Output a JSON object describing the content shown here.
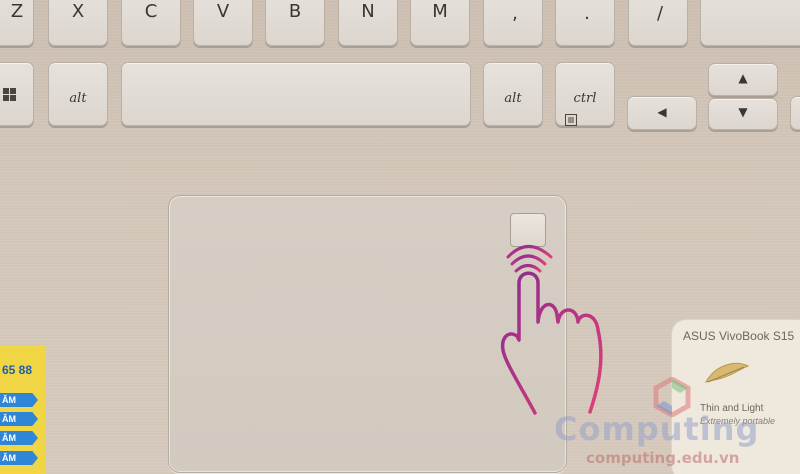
{
  "keys_row1": [
    {
      "id": "z",
      "label": "Z"
    },
    {
      "id": "x",
      "label": "X"
    },
    {
      "id": "c",
      "label": "C"
    },
    {
      "id": "v",
      "label": "V"
    },
    {
      "id": "b",
      "label": "B"
    },
    {
      "id": "n",
      "label": "N"
    },
    {
      "id": "m",
      "label": "M"
    },
    {
      "id": "comma",
      "label": ",",
      "sub": "<"
    },
    {
      "id": "period",
      "label": ".",
      "sub": ">"
    },
    {
      "id": "slash",
      "label": "/",
      "sub": "?"
    }
  ],
  "keys_row2": {
    "windows_icon": "windows-icon",
    "alt_left": "alt",
    "alt_right": "alt",
    "ctrl_right": "ctrl",
    "menu_icon": "menu-icon",
    "arrow_up": "▲",
    "arrow_down": "▼",
    "arrow_left": "◀"
  },
  "sticker_left": {
    "number": "65 88",
    "tags": [
      "ĂM",
      "ĂM",
      "ĂM",
      "ĂM"
    ]
  },
  "sticker_right": {
    "brand": "ASUS VivoBook S15",
    "tagline": "Thin and Light",
    "subtagline": "Extremely portable"
  },
  "watermark": {
    "word": "Computing",
    "url": "computing.edu.vn"
  },
  "colors": {
    "hand_gradient_start": "#8b2a8e",
    "hand_gradient_end": "#e0407a",
    "sticker_yellow": "#f0d545",
    "sticker_blue": "#2f86d6"
  }
}
